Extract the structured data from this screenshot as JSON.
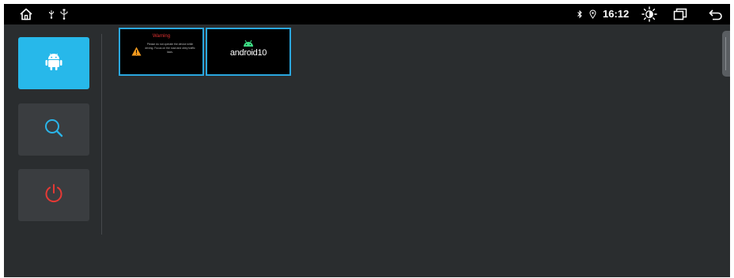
{
  "status_bar": {
    "time": "16:12",
    "icons": [
      "home-icon",
      "usb-icon",
      "usb-alt-icon",
      "bluetooth-icon",
      "location-icon",
      "brightness-icon",
      "recent-apps-icon",
      "back-icon"
    ]
  },
  "sidebar": {
    "items": [
      {
        "icon": "android-icon",
        "active": true
      },
      {
        "icon": "search-icon",
        "active": false
      },
      {
        "icon": "power-icon",
        "active": false
      }
    ]
  },
  "recent_apps": [
    {
      "title": "Warning",
      "text": "Please do not operate the device while driving. Focus on the road and obey traffic laws."
    },
    {
      "label": "android10"
    }
  ],
  "colors": {
    "accent": "#27b8ea",
    "thumb_border": "#2aa7df",
    "warning_red": "#e03232",
    "android_green": "#3ddc84",
    "power_red": "#e53935",
    "background": "#2a2d2f"
  }
}
